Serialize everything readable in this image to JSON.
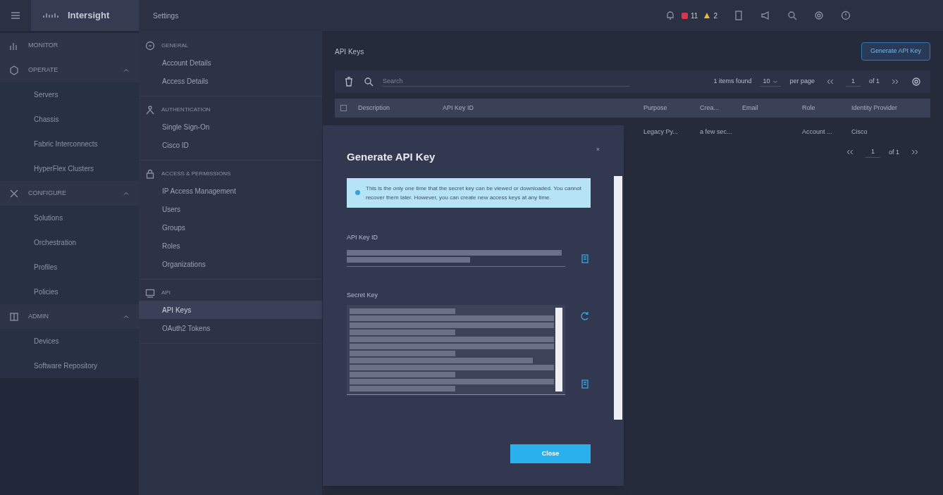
{
  "top_bar": {
    "product": "Intersight",
    "page_title": "Settings",
    "alarms": [
      {
        "kind": "critical",
        "count": "11"
      },
      {
        "kind": "warning",
        "count": "2"
      }
    ]
  },
  "nav": [
    {
      "label": "MONITOR"
    },
    {
      "label": "OPERATE",
      "expanded": true,
      "children": [
        {
          "label": "Servers"
        },
        {
          "label": "Chassis"
        },
        {
          "label": "Fabric Interconnects"
        },
        {
          "label": "HyperFlex Clusters"
        }
      ]
    },
    {
      "label": "CONFIGURE",
      "expanded": true,
      "children": [
        {
          "label": "Solutions"
        },
        {
          "label": "Orchestration"
        },
        {
          "label": "Profiles"
        },
        {
          "label": "Policies"
        }
      ]
    },
    {
      "label": "ADMIN",
      "expanded": true,
      "children": [
        {
          "label": "Devices"
        },
        {
          "label": "Software Repository"
        }
      ]
    }
  ],
  "settings": [
    {
      "label": "GENERAL",
      "items": [
        {
          "label": "Account Details",
          "selected": false
        },
        {
          "label": "Access Details",
          "selected": false
        }
      ]
    },
    {
      "label": "AUTHENTICATION",
      "items": [
        {
          "label": "Single Sign-On",
          "selected": false
        },
        {
          "label": "Cisco ID",
          "selected": false
        }
      ]
    },
    {
      "label": "ACCESS & PERMISSIONS",
      "items": [
        {
          "label": "IP Access Management",
          "selected": false
        },
        {
          "label": "Users",
          "selected": false
        },
        {
          "label": "Groups",
          "selected": false
        },
        {
          "label": "Roles",
          "selected": false
        },
        {
          "label": "Organizations",
          "selected": false
        }
      ]
    },
    {
      "label": "API",
      "items": [
        {
          "label": "API Keys",
          "selected": true
        },
        {
          "label": "OAuth2 Tokens",
          "selected": false
        }
      ]
    }
  ],
  "main": {
    "title": "API Keys",
    "generate_button": "Generate API Key",
    "toolbar": {
      "search_placeholder": "Search",
      "found": "1 items found",
      "per_page_value": "10",
      "per_page_label": "per page",
      "page": "1",
      "of": "of 1"
    },
    "select_all_checked": false,
    "columns": [
      "Description",
      "API Key ID",
      "Purpose",
      "Crea...",
      "Email",
      "Role",
      "Identity Provider"
    ],
    "row": {
      "purpose": "Legacy Py...",
      "created": "a few sec...",
      "role": "Account ...",
      "identity_provider": "Cisco"
    },
    "bottom_pager": {
      "page": "1",
      "of": "of 1"
    }
  },
  "modal": {
    "title": "Generate API Key",
    "close": "×",
    "info": "This is the only one time that the secret key can be viewed or downloaded. You cannot recover them later. However, you can create new access keys at any time.",
    "key_id_label": "API Key ID",
    "secret_label": "Secret Key",
    "button": "Close"
  }
}
